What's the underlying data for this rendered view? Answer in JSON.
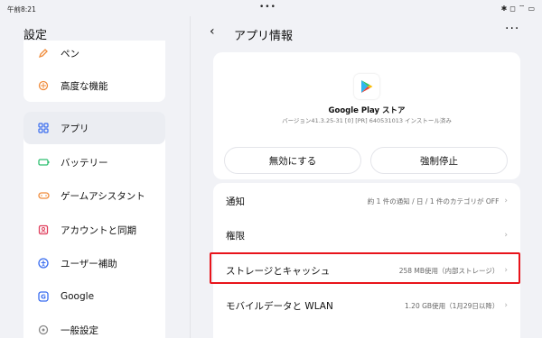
{
  "status_bar": {
    "time": "午前8:21",
    "dots": "•••",
    "icons": [
      "✱",
      "◻",
      "⌔",
      "▭"
    ]
  },
  "left": {
    "title": "設定",
    "top_items": [
      {
        "label": "ペン",
        "icon": "pen-icon",
        "color": "#f08c3c"
      },
      {
        "label": "高度な機能",
        "icon": "advanced-features-icon",
        "color": "#f08c3c"
      }
    ],
    "items": [
      {
        "label": "アプリ",
        "icon": "apps-icon",
        "color": "#3a6df0",
        "active": true
      },
      {
        "label": "バッテリー",
        "icon": "battery-icon",
        "color": "#2fbf71"
      },
      {
        "label": "ゲームアシスタント",
        "icon": "game-icon",
        "color": "#f08c3c"
      },
      {
        "label": "アカウントと同期",
        "icon": "account-sync-icon",
        "color": "#e0405e"
      },
      {
        "label": "ユーザー補助",
        "icon": "accessibility-icon",
        "color": "#3a6df0"
      },
      {
        "label": "Google",
        "icon": "google-icon",
        "color": "#3a6df0"
      },
      {
        "label": "一般設定",
        "icon": "general-settings-icon",
        "color": "#888888"
      }
    ]
  },
  "right": {
    "title": "アプリ情報",
    "back": "‹",
    "more": "···",
    "app": {
      "name": "Google Play ストア",
      "version": "バージョン41.3.25-31 [0] [PR] 640531013 インストール済み"
    },
    "buttons": {
      "disable": "無効にする",
      "force_stop": "強制停止"
    },
    "rows": [
      {
        "label": "通知",
        "value": "約 1 件の通知 / 日 / 1 件のカテゴリが OFF"
      },
      {
        "label": "権限",
        "value": ""
      },
      {
        "label": "ストレージとキャッシュ",
        "value": "258 MB使用（内部ストレージ）"
      },
      {
        "label": "モバイルデータと WLAN",
        "value": "1.20 GB使用（1月29日以降）"
      }
    ]
  },
  "colors": {
    "highlight": "#e8141b",
    "active_bg": "#ebedf2",
    "accent": "#3a6df0"
  }
}
